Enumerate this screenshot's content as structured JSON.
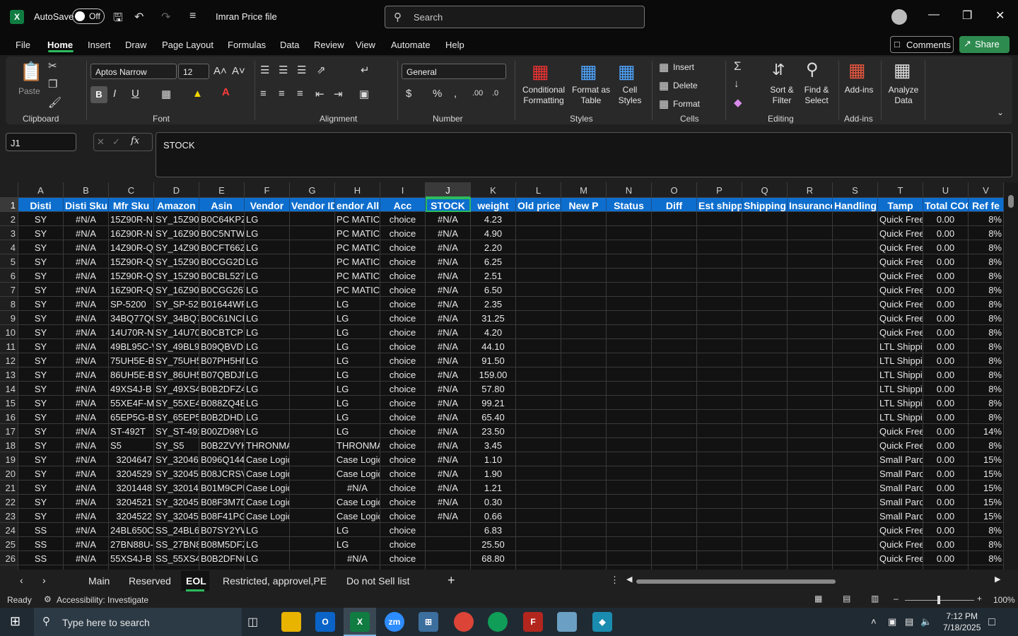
{
  "titlebar": {
    "autosave_label": "AutoSave",
    "toggle_state": "Off",
    "filename": "Imran Price file",
    "search_placeholder": "Search"
  },
  "menu": {
    "items": [
      "File",
      "Home",
      "Insert",
      "Draw",
      "Page Layout",
      "Formulas",
      "Data",
      "Review",
      "View",
      "Automate",
      "Help"
    ],
    "active": "Home",
    "comments": "Comments",
    "share": "Share"
  },
  "ribbon": {
    "paste": "Paste",
    "clipboard": "Clipboard",
    "font_name": "Aptos Narrow",
    "font_size": "12",
    "font": "Font",
    "alignment": "Alignment",
    "number_format": "General",
    "number": "Number",
    "conditional_formatting": [
      "Conditional",
      "Formatting"
    ],
    "format_as_table": [
      "Format as",
      "Table"
    ],
    "cell_styles": [
      "Cell",
      "Styles"
    ],
    "styles": "Styles",
    "insert": "Insert",
    "delete": "Delete",
    "format": "Format",
    "cells": "Cells",
    "sort_filter": [
      "Sort &",
      "Filter"
    ],
    "find_select": [
      "Find &",
      "Select"
    ],
    "editing": "Editing",
    "addins": "Add-ins",
    "addins_group": "Add-ins",
    "analyze": [
      "Analyze",
      "Data"
    ],
    "bold": "B",
    "italic": "I",
    "underline": "U"
  },
  "formula_bar": {
    "name_box": "J1",
    "formula": "STOCK"
  },
  "grid": {
    "columns": [
      "A",
      "B",
      "C",
      "D",
      "E",
      "F",
      "G",
      "H",
      "I",
      "J",
      "K",
      "L",
      "M",
      "N",
      "O",
      "P",
      "Q",
      "R",
      "S",
      "T",
      "U",
      "V"
    ],
    "selected_column": "J",
    "headers": [
      "Disti",
      "Disti Sku",
      "Mfr Sku",
      "Amazon",
      "Asin",
      "Vendor",
      "Vendor ID",
      "Vendor Alliance",
      "Acc",
      "STOCK",
      "weight",
      "Old price",
      "New P",
      "Status",
      "Diff",
      "Est shipp",
      "Shipping",
      "Insurance",
      "Handling",
      "Tamp",
      "Total COG",
      "Ref fe"
    ],
    "header_display": [
      "Disti",
      "Disti Sku",
      "Mfr Sku",
      "Amazon",
      "Asin",
      "Vendor",
      "Vendor ID",
      "endor Allia",
      "Acc",
      "STOCK",
      "weight",
      "Old price",
      "New P",
      "Status",
      "Diff",
      "Est shipp",
      "Shipping",
      "Insurance",
      "Handling",
      "Tamp",
      "Total COG",
      "Ref fe"
    ],
    "rows": [
      [
        "SY",
        "#N/A",
        "15Z90R-N.",
        "SY_15Z90R",
        "B0C64KPZ",
        "LG",
        "",
        "PC MATIC",
        "choice",
        "#N/A",
        "4.23",
        "",
        "",
        "",
        "",
        "",
        "",
        "",
        "",
        "Quick Free",
        "0.00",
        "8%"
      ],
      [
        "SY",
        "#N/A",
        "16Z90R-N.",
        "SY_16Z90R",
        "B0C5NTWY",
        "LG",
        "",
        "PC MATIC",
        "choice",
        "#N/A",
        "4.90",
        "",
        "",
        "",
        "",
        "",
        "",
        "",
        "",
        "Quick Free",
        "0.00",
        "8%"
      ],
      [
        "SY",
        "#N/A",
        "14Z90R-Q.",
        "SY_14Z90R",
        "B0CFT66Z",
        "LG",
        "",
        "PC MATIC",
        "choice",
        "#N/A",
        "2.20",
        "",
        "",
        "",
        "",
        "",
        "",
        "",
        "",
        "Quick Free",
        "0.00",
        "8%"
      ],
      [
        "SY",
        "#N/A",
        "15Z90R-Q.",
        "SY_15Z90R",
        "B0CGG2DJ",
        "LG",
        "",
        "PC MATIC",
        "choice",
        "#N/A",
        "6.25",
        "",
        "",
        "",
        "",
        "",
        "",
        "",
        "",
        "Quick Free",
        "0.00",
        "8%"
      ],
      [
        "SY",
        "#N/A",
        "15Z90R-Q.",
        "SY_15Z90R",
        "B0CBL527",
        "LG",
        "",
        "PC MATIC",
        "choice",
        "#N/A",
        "2.51",
        "",
        "",
        "",
        "",
        "",
        "",
        "",
        "",
        "Quick Free",
        "0.00",
        "8%"
      ],
      [
        "SY",
        "#N/A",
        "16Z90R-Q.",
        "SY_16Z90R",
        "B0CGG26T",
        "LG",
        "",
        "PC MATIC",
        "choice",
        "#N/A",
        "6.50",
        "",
        "",
        "",
        "",
        "",
        "",
        "",
        "",
        "Quick Free",
        "0.00",
        "8%"
      ],
      [
        "SY",
        "#N/A",
        "SP-5200",
        "SY_SP-520",
        "B01644WP",
        "LG",
        "",
        "LG",
        "choice",
        "#N/A",
        "2.35",
        "",
        "",
        "",
        "",
        "",
        "",
        "",
        "",
        "Quick Free",
        "0.00",
        "8%"
      ],
      [
        "SY",
        "#N/A",
        "34BQ77QC",
        "SY_34BQ77",
        "B0C61NCE",
        "LG",
        "",
        "LG",
        "choice",
        "#N/A",
        "31.25",
        "",
        "",
        "",
        "",
        "",
        "",
        "",
        "",
        "Quick Free",
        "0.00",
        "8%"
      ],
      [
        "SY",
        "#N/A",
        "14U70R-N",
        "SY_14U70R",
        "B0CBTCPB",
        "LG",
        "",
        "LG",
        "choice",
        "#N/A",
        "4.20",
        "",
        "",
        "",
        "",
        "",
        "",
        "",
        "",
        "Quick Free",
        "0.00",
        "8%"
      ],
      [
        "SY",
        "#N/A",
        "49BL95C-V",
        "SY_49BL95",
        "B09QBVDL",
        "LG",
        "",
        "LG",
        "choice",
        "#N/A",
        "44.10",
        "",
        "",
        "",
        "",
        "",
        "",
        "",
        "",
        "LTL Shippi",
        "0.00",
        "8%"
      ],
      [
        "SY",
        "#N/A",
        "75UH5E-B",
        "SY_75UH5",
        "B07PH5HN",
        "LG",
        "",
        "LG",
        "choice",
        "#N/A",
        "91.50",
        "",
        "",
        "",
        "",
        "",
        "",
        "",
        "",
        "LTL Shippi",
        "0.00",
        "8%"
      ],
      [
        "SY",
        "#N/A",
        "86UH5E-B",
        "SY_86UH5",
        "B07QBDJN",
        "LG",
        "",
        "LG",
        "choice",
        "#N/A",
        "159.00",
        "",
        "",
        "",
        "",
        "",
        "",
        "",
        "",
        "LTL Shippi",
        "0.00",
        "8%"
      ],
      [
        "SY",
        "#N/A",
        "49XS4J-B",
        "SY_49XS4J",
        "B0B2DFZ4",
        "LG",
        "",
        "LG",
        "choice",
        "#N/A",
        "57.80",
        "",
        "",
        "",
        "",
        "",
        "",
        "",
        "",
        "LTL Shippi",
        "0.00",
        "8%"
      ],
      [
        "SY",
        "#N/A",
        "55XE4F-M",
        "SY_55XE4F",
        "B088ZQ4B",
        "LG",
        "",
        "LG",
        "choice",
        "#N/A",
        "99.21",
        "",
        "",
        "",
        "",
        "",
        "",
        "",
        "",
        "LTL Shippi",
        "0.00",
        "8%"
      ],
      [
        "SY",
        "#N/A",
        "65EP5G-B",
        "SY_65EP5G",
        "B0B2DHDZ",
        "LG",
        "",
        "LG",
        "choice",
        "#N/A",
        "65.40",
        "",
        "",
        "",
        "",
        "",
        "",
        "",
        "",
        "LTL Shippi",
        "0.00",
        "8%"
      ],
      [
        "SY",
        "#N/A",
        "ST-492T",
        "SY_ST-492",
        "B00ZD98Y",
        "LG",
        "",
        "LG",
        "choice",
        "#N/A",
        "23.50",
        "",
        "",
        "",
        "",
        "",
        "",
        "",
        "",
        "Quick Free",
        "0.00",
        "14%"
      ],
      [
        "SY",
        "#N/A",
        "S5",
        "SY_S5",
        "B0B2ZVYK",
        "THRONMAX LLC",
        "",
        "THRONMA",
        "choice",
        "#N/A",
        "3.45",
        "",
        "",
        "",
        "",
        "",
        "",
        "",
        "",
        "Quick Free",
        "0.00",
        "8%"
      ],
      [
        "SY",
        "#N/A",
        "3204647",
        "SY_320464",
        "B096Q144",
        "Case Logic",
        "",
        "Case Logic",
        "choice",
        "#N/A",
        "1.10",
        "",
        "",
        "",
        "",
        "",
        "",
        "",
        "",
        "Small Parc",
        "0.00",
        "15%"
      ],
      [
        "SY",
        "#N/A",
        "3204529",
        "SY_320452",
        "B08JCRSV",
        "Case Logic",
        "",
        "Case Logic",
        "choice",
        "#N/A",
        "1.90",
        "",
        "",
        "",
        "",
        "",
        "",
        "",
        "",
        "Small Parc",
        "0.00",
        "15%"
      ],
      [
        "SY",
        "#N/A",
        "3201448",
        "SY_320144",
        "B01M9CPE",
        "Case Logic",
        "",
        "#N/A",
        "choice",
        "#N/A",
        "1.21",
        "",
        "",
        "",
        "",
        "",
        "",
        "",
        "",
        "Small Parc",
        "0.00",
        "15%"
      ],
      [
        "SY",
        "#N/A",
        "3204521",
        "SY_320452",
        "B08F3M7D",
        "Case Logic",
        "",
        "Case Logic",
        "choice",
        "#N/A",
        "0.30",
        "",
        "",
        "",
        "",
        "",
        "",
        "",
        "",
        "Small Parc",
        "0.00",
        "15%"
      ],
      [
        "SY",
        "#N/A",
        "3204522",
        "SY_320452",
        "B08F41PG",
        "Case Logic",
        "",
        "Case Logic",
        "choice",
        "#N/A",
        "0.66",
        "",
        "",
        "",
        "",
        "",
        "",
        "",
        "",
        "Small Parc",
        "0.00",
        "15%"
      ],
      [
        "SS",
        "#N/A",
        "24BL650C-",
        "SS_24BL65",
        "B07SY2YW",
        "LG",
        "",
        "LG",
        "choice",
        "",
        "6.83",
        "",
        "",
        "",
        "",
        "",
        "",
        "",
        "",
        "Quick Free",
        "0.00",
        "8%"
      ],
      [
        "SS",
        "#N/A",
        "27BN88U-",
        "SS_27BN88",
        "B08M5DFZ",
        "LG",
        "",
        "LG",
        "choice",
        "",
        "25.50",
        "",
        "",
        "",
        "",
        "",
        "",
        "",
        "",
        "Quick Free",
        "0.00",
        "8%"
      ],
      [
        "SS",
        "#N/A",
        "55XS4J-B",
        "SS_55XS4J",
        "B0B2DFNC",
        "LG",
        "",
        "#N/A",
        "choice",
        "",
        "68.80",
        "",
        "",
        "",
        "",
        "",
        "",
        "",
        "",
        "Quick Free",
        "0.00",
        "8%"
      ]
    ]
  },
  "sheets": {
    "tabs": [
      "Main",
      "Reserved",
      "EOL",
      "Restricted, approvel,PE",
      "Do not Sell list"
    ],
    "active": "EOL"
  },
  "status": {
    "ready": "Ready",
    "accessibility": "Accessibility: Investigate",
    "zoom": "100%"
  },
  "taskbar": {
    "search_placeholder": "Type here to search",
    "time": "7:12 PM",
    "date": "7/18/2025"
  },
  "colors": {
    "header_fill": "#0d6ece",
    "accent": "#2cbb5d",
    "share": "#2e8b4f"
  }
}
